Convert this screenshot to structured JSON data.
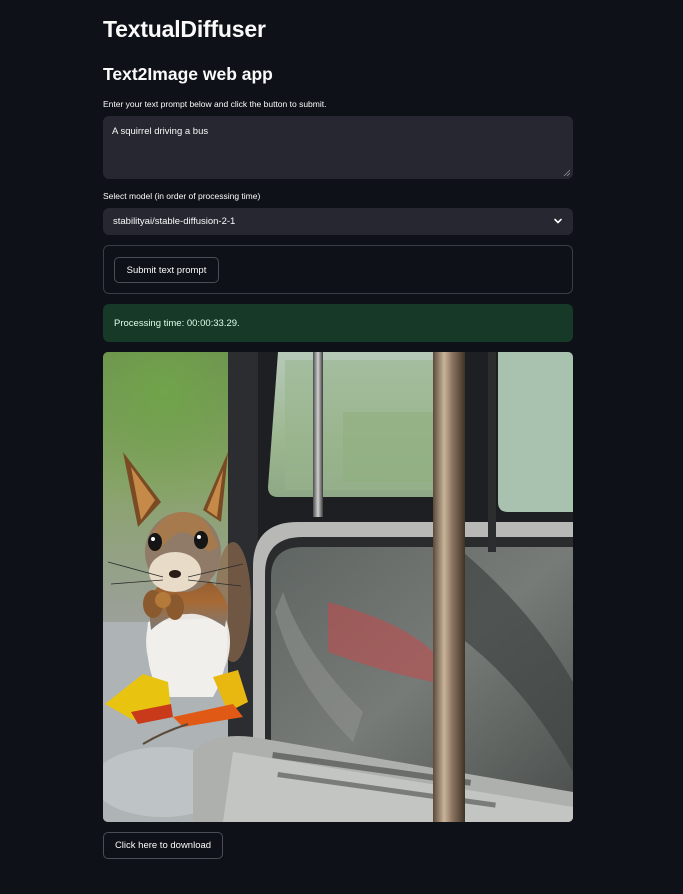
{
  "app": {
    "title": "TextualDiffuser",
    "subtitle": "Text2Image web app"
  },
  "prompt": {
    "instruction": "Enter your text prompt below and click the button to submit.",
    "value": "A squirrel driving a bus"
  },
  "model": {
    "label": "Select model (in order of processing time)",
    "selected": "stabilityai/stable-diffusion-2-1"
  },
  "form": {
    "submit_label": "Submit text prompt"
  },
  "status": {
    "message": "Processing time: 00:00:33.29.",
    "color": "#173928"
  },
  "result": {
    "image_subject": "squirrel-on-bus"
  },
  "download": {
    "label": "Click here to download"
  },
  "theme": {
    "background": "#0e1117",
    "input_background": "#262730",
    "success_background": "#173928"
  }
}
